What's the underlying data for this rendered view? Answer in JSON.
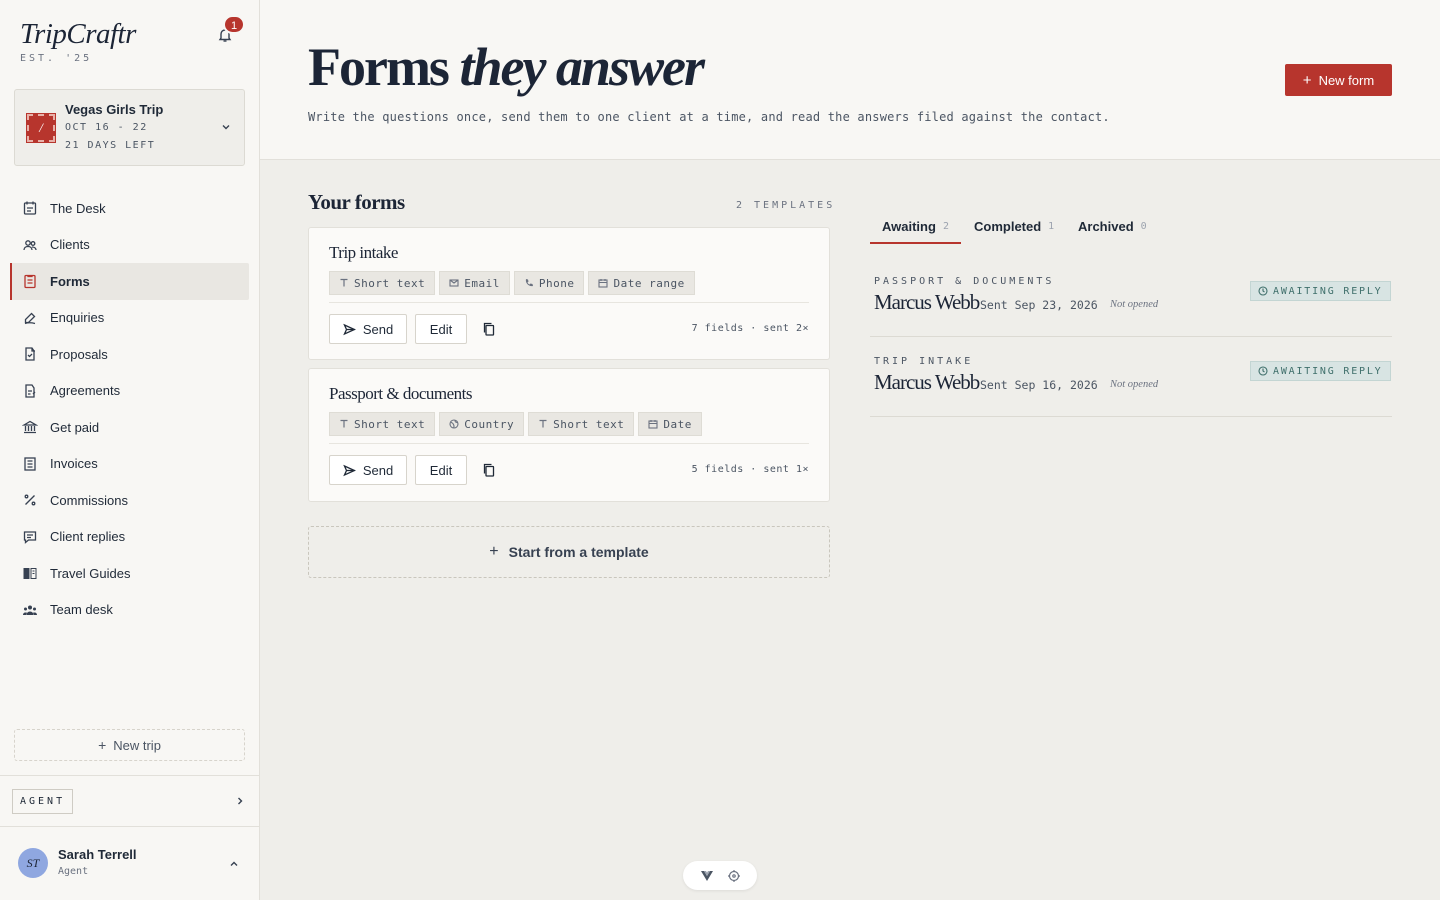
{
  "brand": {
    "name": "TripCraftr",
    "est": "EST. '25"
  },
  "notifications": {
    "count": "1"
  },
  "trip": {
    "stamp": "/",
    "name": "Vegas Girls Trip",
    "dates": "OCT 16 - 22",
    "days_left": "21 DAYS LEFT"
  },
  "nav": [
    {
      "label": "The Desk",
      "icon": "desk-icon"
    },
    {
      "label": "Clients",
      "icon": "clients-icon"
    },
    {
      "label": "Forms",
      "icon": "forms-icon",
      "active": true
    },
    {
      "label": "Enquiries",
      "icon": "enquiries-icon"
    },
    {
      "label": "Proposals",
      "icon": "proposals-icon"
    },
    {
      "label": "Agreements",
      "icon": "agreements-icon"
    },
    {
      "label": "Get paid",
      "icon": "bank-icon"
    },
    {
      "label": "Invoices",
      "icon": "invoice-icon"
    },
    {
      "label": "Commissions",
      "icon": "percent-icon"
    },
    {
      "label": "Client replies",
      "icon": "message-icon"
    },
    {
      "label": "Travel Guides",
      "icon": "book-icon"
    },
    {
      "label": "Team desk",
      "icon": "team-icon"
    }
  ],
  "sidebar_footer": {
    "new_trip": "New trip",
    "agent": "AGENT"
  },
  "user": {
    "initials": "ST",
    "name": "Sarah Terrell",
    "role": "Agent"
  },
  "header": {
    "title_plain": "Forms",
    "title_italic": "they answer",
    "subtitle": "Write the questions once, send them to one client at a time, and read the answers filed against the contact.",
    "new_form": "New form"
  },
  "forms": {
    "title": "Your forms",
    "count": "2 TEMPLATES",
    "items": [
      {
        "name": "Trip intake",
        "fields": [
          "Short text",
          "Email",
          "Phone",
          "Date range"
        ],
        "send": "Send",
        "edit": "Edit",
        "meta": "7 fields · sent 2×"
      },
      {
        "name": "Passport & documents",
        "fields": [
          "Short text",
          "Country",
          "Short text",
          "Date"
        ],
        "send": "Send",
        "edit": "Edit",
        "meta": "5 fields · sent 1×"
      }
    ],
    "template_btn": "Start from a template"
  },
  "tabs": [
    {
      "label": "Awaiting",
      "count": "2",
      "active": true
    },
    {
      "label": "Completed",
      "count": "1"
    },
    {
      "label": "Archived",
      "count": "0"
    }
  ],
  "responses": [
    {
      "form": "PASSPORT & DOCUMENTS",
      "client": "Marcus Webb",
      "sent": "Sent Sep 23, 2026",
      "state": "Not opened",
      "status": "AWAITING REPLY"
    },
    {
      "form": "TRIP INTAKE",
      "client": "Marcus Webb",
      "sent": "Sent Sep 16, 2026",
      "state": "Not opened",
      "status": "AWAITING REPLY"
    }
  ],
  "colors": {
    "accent": "#b7352d",
    "status": "#3f6f6b",
    "background": "#efeeea"
  }
}
